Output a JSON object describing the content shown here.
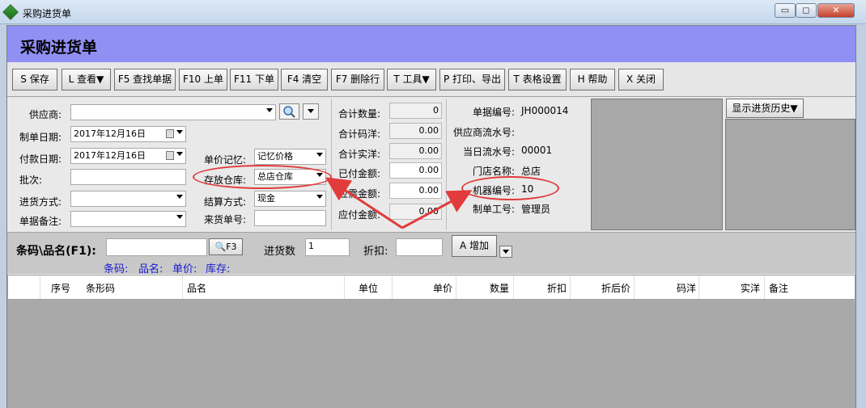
{
  "window": {
    "title": "采购进货单",
    "min_label": "▭",
    "max_label": "◻",
    "close_label": "✕"
  },
  "page": {
    "title": "采购进货单"
  },
  "toolbar": {
    "buttons": [
      "S 保存",
      "L 查看▼",
      "F5 查找单据",
      "F10 上单",
      "F11 下单",
      "F4 清空",
      "F7 删除行",
      "T 工具▼",
      "P 打印、导出",
      "T 表格设置",
      "H 帮助",
      "X 关闭"
    ]
  },
  "form": {
    "supplier_label": "供应商:",
    "supplier_value": "",
    "create_date_label": "制单日期:",
    "create_date_value": "2017年12月16日",
    "pay_date_label": "付款日期:",
    "pay_date_value": "2017年12月16日",
    "batch_label": "批次:",
    "batch_value": "",
    "method_label": "进货方式:",
    "method_value": "",
    "remark_label": "单据备注:",
    "remark_value": "",
    "price_memory_label": "单价记忆:",
    "price_memory_value": "记忆价格",
    "warehouse_label": "存放仓库:",
    "warehouse_value": "总店仓库",
    "settle_label": "结算方式:",
    "settle_value": "现金",
    "incoming_no_label": "来货单号:",
    "incoming_no_value": ""
  },
  "totals": {
    "qty_label": "合计数量:",
    "qty_value": "0",
    "code_yang_label": "合计码洋:",
    "code_yang_value": "0.00",
    "real_yang_label": "合计实洋:",
    "real_yang_value": "0.00",
    "paid_label": "已付金额:",
    "paid_value": "0.00",
    "due_label": "应需金额:",
    "due_value": "0.00",
    "payable_label": "应付金额:",
    "payable_value": "0.00"
  },
  "info": {
    "doc_no_label": "单据编号:",
    "doc_no_value": "JH000014",
    "supplier_serial_label": "供应商流水号:",
    "supplier_serial_value": "",
    "daily_serial_label": "当日流水号:",
    "daily_serial_value": "00001",
    "store_label": "门店名称:",
    "store_value": "总店",
    "machine_label": "机器编号:",
    "machine_value": "10",
    "operator_label": "制单工号:",
    "operator_value": "管理员"
  },
  "history_button": "显示进货历史▼",
  "entry": {
    "barcode_label": "条码\\品名(F1):",
    "barcode_value": "",
    "search_key": "F3",
    "qty_label": "进货数",
    "qty_value": "1",
    "discount_label": "折扣:",
    "discount_value": "",
    "add_button": "A 增加",
    "hint_barcode": "条码:",
    "hint_name": "品名:",
    "hint_price": "单价:",
    "hint_stock": "库存:"
  },
  "grid": {
    "columns": [
      "序号",
      "条形码",
      "品名",
      "单位",
      "单价",
      "数量",
      "折扣",
      "折后价",
      "码洋",
      "实洋",
      "备注"
    ]
  },
  "colors": {
    "header_band": "#8f8ff4",
    "annotation": "#e23b3b",
    "hint_text": "#1a1ad6"
  }
}
